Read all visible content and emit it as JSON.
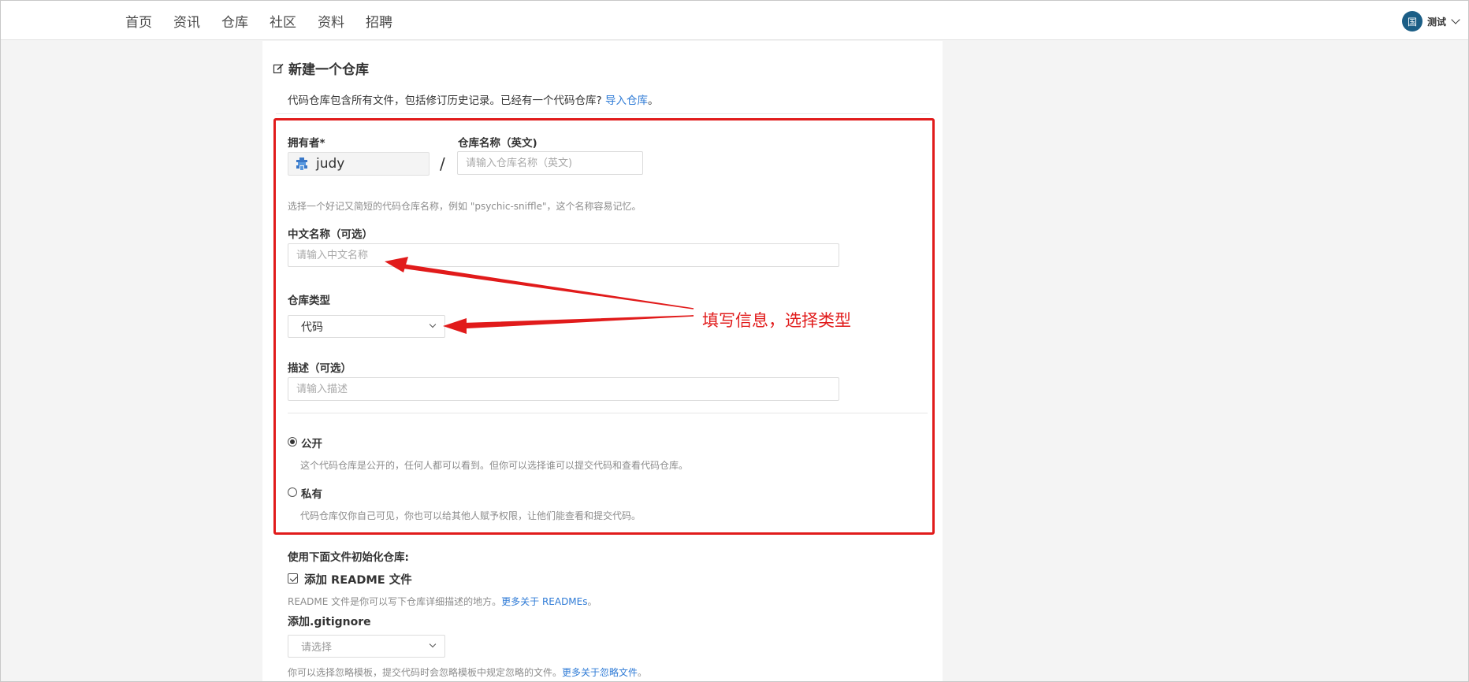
{
  "nav": {
    "items": [
      "首页",
      "资讯",
      "仓库",
      "社区",
      "资料",
      "招聘"
    ]
  },
  "user": {
    "avatar_text": "国",
    "name": "测试"
  },
  "page": {
    "title": "新建一个仓库",
    "intro_text": "代码仓库包含所有文件，包括修订历史记录。已经有一个代码仓库?",
    "import_link": "导入仓库",
    "intro_end": "。"
  },
  "form": {
    "owner_label": "拥有者*",
    "owner_value": "judy",
    "slash": "/",
    "repo_name_label": "仓库名称（英文)",
    "repo_name_placeholder": "请输入仓库名称（英文)",
    "repo_name_hint": "选择一个好记又简短的代码仓库名称，例如 \"psychic-sniffle\"，这个名称容易记忆。",
    "cn_name_label": "中文名称（可选）",
    "cn_name_placeholder": "请输入中文名称",
    "type_label": "仓库类型",
    "type_value": "代码",
    "desc_label": "描述（可选）",
    "desc_placeholder": "请输入描述",
    "public_label": "公开",
    "public_hint": "这个代码仓库是公开的，任何人都可以看到。但你可以选择谁可以提交代码和查看代码仓库。",
    "private_label": "私有",
    "private_hint": "代码仓库仅你自己可见，你也可以给其他人赋予权限，让他们能查看和提交代码。",
    "visibility": "public"
  },
  "init": {
    "heading": "使用下面文件初始化仓库:",
    "readme_label": "添加 README 文件",
    "readme_checked": true,
    "readme_hint": "README 文件是你可以写下仓库详细描述的地方。",
    "readme_link": "更多关于 READMEs",
    "readme_end": "。",
    "gitignore_label": "添加.gitignore",
    "gitignore_value": "请选择",
    "gitignore_hint": "你可以选择忽略模板，提交代码时会忽略模板中规定忽略的文件。",
    "gitignore_link": "更多关于忽略文件",
    "gitignore_end": "。"
  },
  "annotation": {
    "text": "填写信息，选择类型",
    "color": "#e11b1b"
  },
  "colors": {
    "accent_link": "#2f7bd6",
    "avatar_bg": "#1b5e86",
    "annotation_red": "#e11b1b"
  }
}
